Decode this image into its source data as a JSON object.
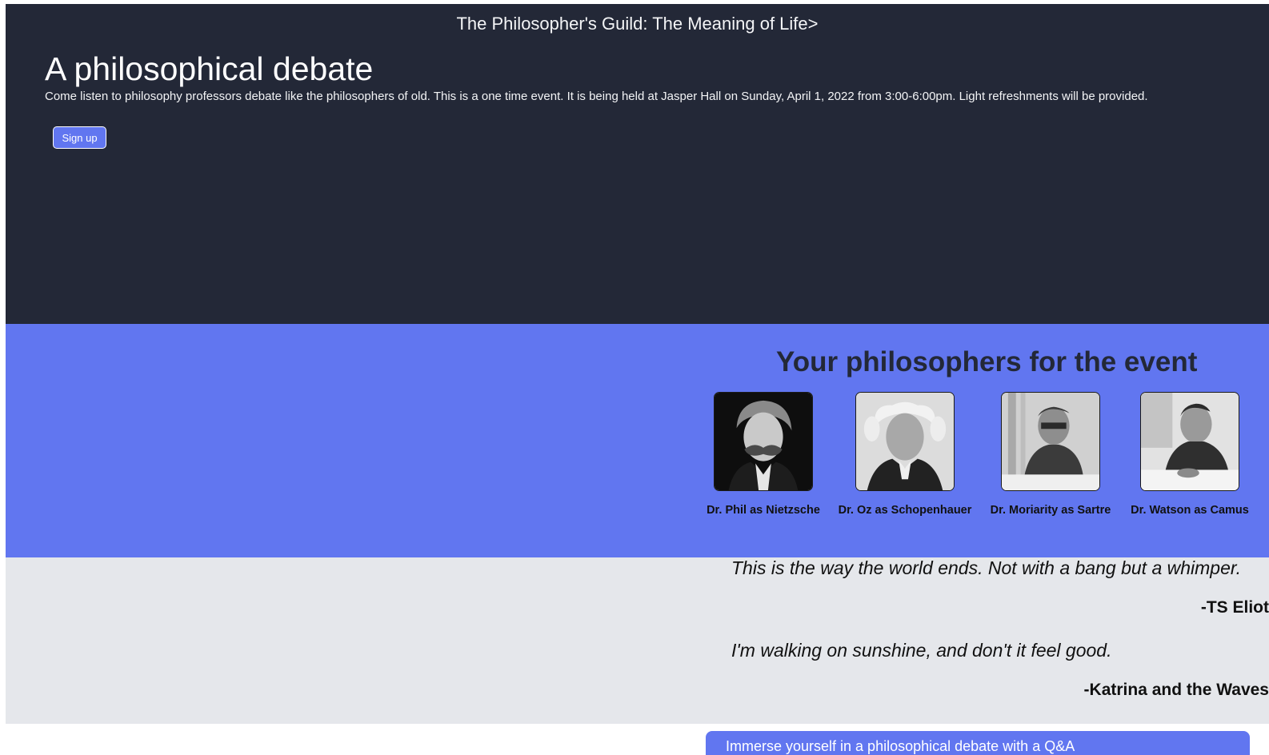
{
  "hero": {
    "site_title": "The Philosopher's Guild: The Meaning of Life>",
    "heading": "A philosophical debate",
    "description": "Come listen to philosophy professors debate like the philosophers of old. This is a one time event. It is being held at Jasper Hall on Sunday, April 1, 2022 from 3:00-6:00pm. Light refreshments will be provided.",
    "signup_label": "Sign up"
  },
  "philosophers": {
    "heading": "Your philosophers for the event",
    "people": [
      {
        "name": "Dr. Phil as Nietzsche",
        "icon": "nietzsche-portrait"
      },
      {
        "name": "Dr. Oz as Schopenhauer",
        "icon": "schopenhauer-portrait"
      },
      {
        "name": "Dr. Moriarity as Sartre",
        "icon": "sartre-portrait"
      },
      {
        "name": "Dr. Watson as Camus",
        "icon": "camus-portrait"
      }
    ]
  },
  "quotes": [
    {
      "text": "This is the way the world ends. Not with a bang but a whimper.",
      "author": "-TS Eliot"
    },
    {
      "text": "I'm walking on sunshine, and don't it feel good.",
      "author": "-Katrina and the Waves"
    }
  ],
  "cta": {
    "text": "Immerse yourself in a philosophical debate with a Q&A"
  },
  "colors": {
    "hero_bg": "#232837",
    "accent": "#6176f0",
    "quotes_bg": "#e5e7eb"
  }
}
